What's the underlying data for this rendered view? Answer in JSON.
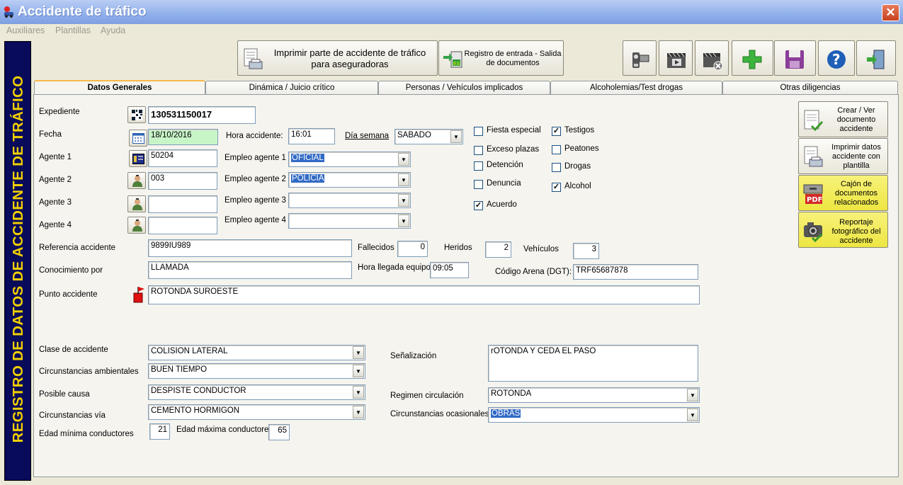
{
  "window": {
    "title": "Accidente de tráfico",
    "close_icon": "close-icon"
  },
  "menu": [
    "Auxiliares",
    "Plantillas",
    "Ayuda"
  ],
  "banner": "REGISTRO DE DATOS DE ACCIDENTE DE TRÁFICO",
  "toolbar": {
    "print_insurers": "Imprimir parte de accidente de tráfico para aseguradoras",
    "registry": "Registro de entrada - Salida de documentos"
  },
  "tabs": [
    "Datos Generales",
    "Dinámica / Juicio crítico",
    "Personas / Vehículos implicados",
    "Alcoholemias/Test drogas",
    "Otras diligencias"
  ],
  "labels": {
    "expediente": "Expediente",
    "fecha": "Fecha",
    "agente1": "Agente 1",
    "agente2": "Agente 2",
    "agente3": "Agente 3",
    "agente4": "Agente 4",
    "hora": "Hora accidente:",
    "dia": "Día semana",
    "empleo1": "Empleo agente 1",
    "empleo2": "Empleo agente 2",
    "empleo3": "Empleo agente 3",
    "empleo4": "Empleo agente 4",
    "referencia": "Referencia accidente",
    "fallecidos": "Fallecidos",
    "heridos": "Heridos",
    "vehiculos": "Vehículos",
    "conocimiento": "Conocimiento por",
    "hora_llegada": "Hora llegada equipo",
    "codigo_arena": "Código Arena (DGT):",
    "punto": "Punto accidente",
    "clase": "Clase de accidente",
    "circ_amb": "Circunstancias ambientales",
    "causa": "Posible causa",
    "circ_via": "Circunstancias vía",
    "edad_min": "Edad mínima conductores",
    "edad_max": "Edad máxima conductores",
    "senalizacion": "Señalización",
    "regimen": "Regimen circulación",
    "circ_ocas": "Circunstancias ocasionales"
  },
  "values": {
    "expediente": "130531150017",
    "fecha": "18/10/2016",
    "agente1": "50204",
    "agente2": "003",
    "agente3": "",
    "agente4": "",
    "hora": "16:01",
    "dia": "SABADO",
    "empleo1": "OFICIAL",
    "empleo2": "POLICIA",
    "empleo3": "",
    "empleo4": "",
    "referencia": "9899IU989",
    "fallecidos": "0",
    "heridos": "2",
    "vehiculos": "3",
    "conocimiento": "LLAMADA",
    "hora_llegada": "09:05",
    "codigo_arena": "TRF65687878",
    "punto": "ROTONDA SUROESTE",
    "clase": "COLISION LATERAL",
    "circ_amb": "BUEN TIEMPO",
    "causa": "DESPISTE CONDUCTOR",
    "circ_via": "CEMENTO HORMIGON",
    "edad_min": "21",
    "edad_max": "65",
    "senalizacion": "rOTONDA Y CEDA EL PASO",
    "regimen": "ROTONDA",
    "circ_ocas": "OBRAS"
  },
  "checks": {
    "fiesta": {
      "label": "Fiesta especial",
      "checked": false
    },
    "exceso": {
      "label": "Exceso plazas",
      "checked": false
    },
    "detencion": {
      "label": "Detención",
      "checked": false
    },
    "denuncia": {
      "label": "Denuncia",
      "checked": false
    },
    "acuerdo": {
      "label": "Acuerdo",
      "checked": true
    },
    "testigos": {
      "label": "Testigos",
      "checked": true
    },
    "peatones": {
      "label": "Peatones",
      "checked": false
    },
    "drogas": {
      "label": "Drogas",
      "checked": false
    },
    "alcohol": {
      "label": "Alcohol",
      "checked": true
    }
  },
  "side": {
    "crear": "Crear / Ver documento accidente",
    "imprimir": "Imprimir datos accidente con plantilla",
    "cajon": "Cajón de documentos relacionados",
    "reportaje": "Reportaje fotográfico del accidente"
  },
  "colors": {
    "title_bar": "#8fb0ea",
    "banner_bg": "#080a5a",
    "banner_text": "#f0d000",
    "date_field": "#c8f5c8",
    "highlight": "#f7f27a",
    "selection": "#316ac5"
  }
}
